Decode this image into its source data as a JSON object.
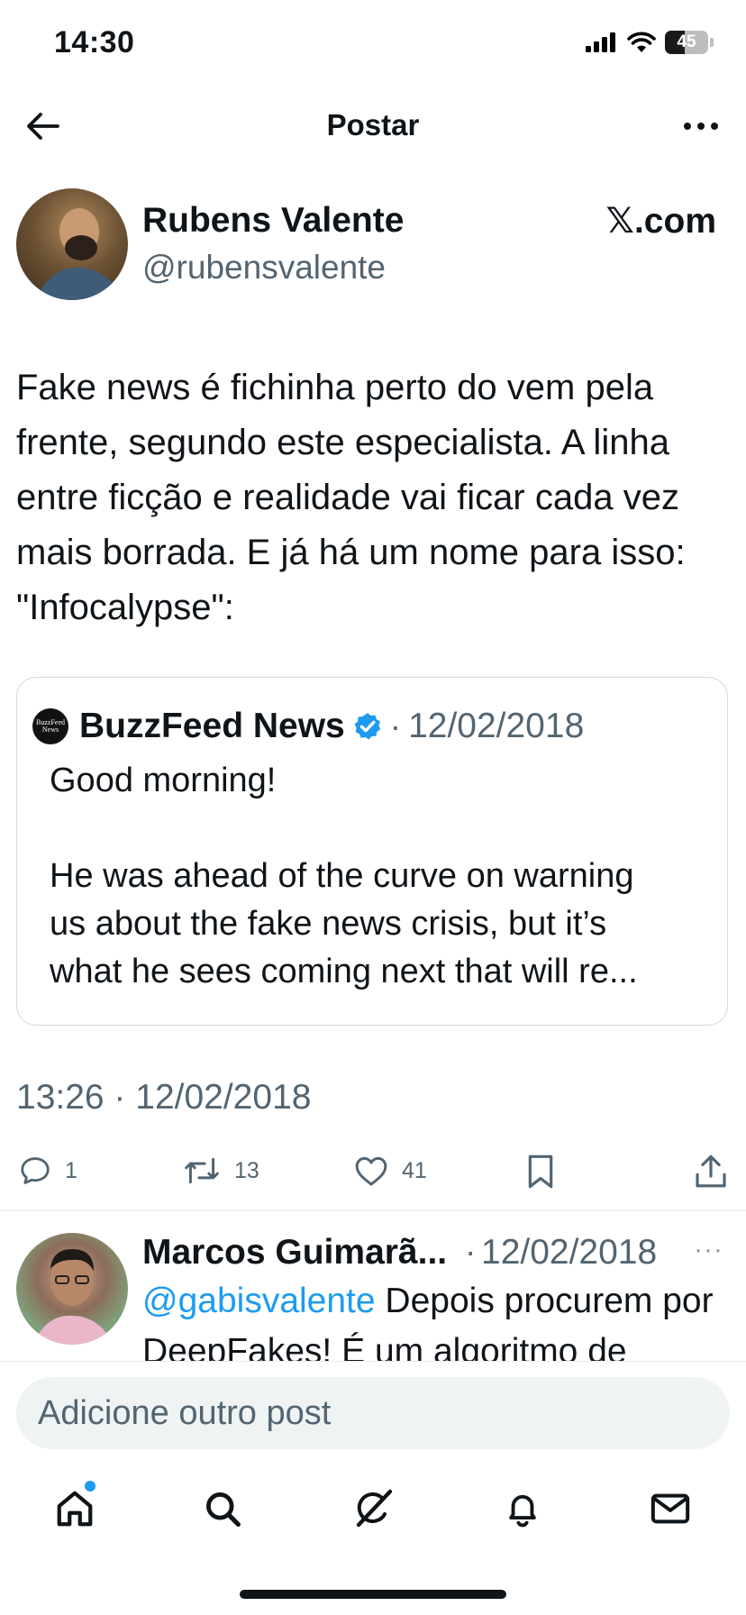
{
  "status_bar": {
    "time": "14:30",
    "battery_level": "45",
    "battery_fraction": 0.45,
    "icons": [
      "signal-icon",
      "wifi-icon",
      "battery-icon"
    ]
  },
  "header": {
    "title": "Postar",
    "back_icon": "arrow-left-icon",
    "more_icon": "more-horizontal-icon"
  },
  "post": {
    "author_name": "Rubens Valente",
    "author_handle": "@rubensvalente",
    "source": "𝕏.com",
    "text": "Fake news é fichinha perto do vem pela frente, segundo este especialista. A linha entre ficção e realidade vai ficar cada vez mais borrada. E já há um nome para isso: \"Infocalypse\":",
    "timestamp": "13:26 · 12/02/2018",
    "actions": {
      "replies": "1",
      "reposts": "13",
      "likes": "41"
    }
  },
  "quote": {
    "logo_text": "BuzzFeed News",
    "author_name": "BuzzFeed News",
    "separator": "·",
    "date": "12/02/2018",
    "lines": [
      "Good morning!",
      "",
      "He was ahead of the curve on warning",
      "us about the fake news crisis, but it’s",
      "what he sees coming next that will re..."
    ]
  },
  "reply": {
    "author_name": "Marcos Guimarã...",
    "separator": "·",
    "date": "12/02/2018",
    "more": "···",
    "mention": "@gabisvalente",
    "text": " Depois procurem por DeepFakes! É um algoritmo de"
  },
  "compose": {
    "placeholder": "Adicione outro post"
  },
  "tabs": [
    "home-icon",
    "search-icon",
    "grok-icon",
    "notifications-icon",
    "messages-icon"
  ],
  "colors": {
    "accent": "#1d9bf0",
    "secondary_text": "#536471",
    "primary_text": "#0f1419"
  }
}
